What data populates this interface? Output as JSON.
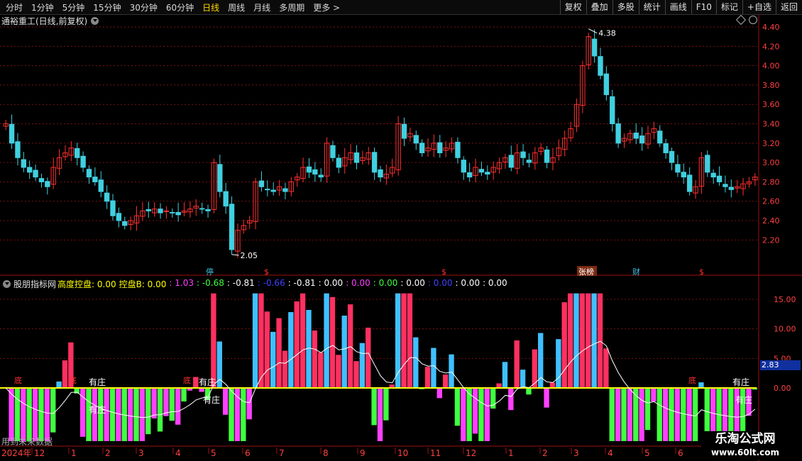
{
  "toolbar": {
    "periods": [
      "分时",
      "1分钟",
      "5分钟",
      "15分钟",
      "30分钟",
      "60分钟",
      "日线",
      "周线",
      "月线",
      "多周期",
      "更多 >"
    ],
    "active_period": "日线",
    "actions": [
      "复权",
      "叠加",
      "多股",
      "统计",
      "画线",
      "F10",
      "标记",
      "+自选",
      "返回"
    ]
  },
  "upper_chart": {
    "title": "通裕重工(日线,前复权)",
    "price_axis_labels": [
      "4.40",
      "4.20",
      "4.00",
      "3.80",
      "3.60",
      "3.40",
      "3.20",
      "3.00",
      "2.80",
      "2.60",
      "2.40",
      "2.20"
    ],
    "max_label": "4.38",
    "min_label": "2.05",
    "event_markers": [
      {
        "text": "停",
        "color": "#40c0e0"
      },
      {
        "text": "$",
        "color": "#ff3030"
      },
      {
        "text": "$",
        "color": "#ff3030"
      },
      {
        "text": "张榜",
        "color": "#ffffff"
      },
      {
        "text": "财",
        "color": "#40c0e0"
      },
      {
        "text": "$",
        "color": "#ff3030"
      }
    ]
  },
  "lower_chart": {
    "title": "股朋指标网",
    "readouts": [
      {
        "text": "高度控盘: 0.00",
        "color": "#ffff00"
      },
      {
        "text": "控盘B: 0.00",
        "color": "#ffff00"
      },
      {
        "text": ": 1.03",
        "color": "#ff40ff"
      },
      {
        "text": ": -0.68",
        "color": "#40ff40"
      },
      {
        "text": ": -0.81",
        "color": "#ffffff"
      },
      {
        "text": ": -0.66",
        "color": "#4040ff"
      },
      {
        "text": ": -0.81",
        "color": "#ffffff"
      },
      {
        "text": ": 0.00",
        "color": "#ffffff"
      },
      {
        "text": ": 0.00",
        "color": "#ff40ff"
      },
      {
        "text": ": 0.00",
        "color": "#40ff40"
      },
      {
        "text": ": 0.00",
        "color": "#ffffff"
      },
      {
        "text": ": 0.00",
        "color": "#4040ff"
      },
      {
        "text": ": 0.00",
        "color": "#ffffff"
      },
      {
        "text": ": 0.00",
        "color": "#ffffff"
      }
    ],
    "axis_labels": [
      "15.00",
      "10.00",
      "5.00",
      "0.00"
    ],
    "current_value": "2.83",
    "signal_labels": [
      "有庄",
      "有庄",
      "有庄",
      "有庄",
      "有庄",
      "有庄"
    ],
    "bottom_labels": [
      "底",
      "底",
      "底",
      "底"
    ],
    "future_note": "用到未来数据"
  },
  "time_axis": {
    "year_label": "2024年",
    "months": [
      "12",
      "1",
      "2",
      "3",
      "4",
      "5",
      "6",
      "7",
      "8",
      "9",
      "10",
      "11",
      "12",
      "1",
      "2",
      "3",
      "4",
      "5",
      "6"
    ]
  },
  "watermark": {
    "line1": "乐淘公式网",
    "line2": "www.60lt.com"
  },
  "colors": {
    "up": "#ff3030",
    "down": "#40d0e0",
    "axis_text": "#ff4040",
    "grid": "#7a1010",
    "yellow_line": "#ffff00"
  },
  "chart_data": {
    "type": "candlestick",
    "ylim": [
      2.05,
      4.4
    ],
    "close_series": [
      3.4,
      3.2,
      3.05,
      2.95,
      2.9,
      2.85,
      2.8,
      2.75,
      2.95,
      3.05,
      3.1,
      3.15,
      3.05,
      2.95,
      2.85,
      2.8,
      2.7,
      2.6,
      2.45,
      2.4,
      2.35,
      2.4,
      2.45,
      2.5,
      2.5,
      2.52,
      2.48,
      2.5,
      2.48,
      2.46,
      2.5,
      2.52,
      2.55,
      2.52,
      2.5,
      3.0,
      2.7,
      2.55,
      2.1,
      2.3,
      2.35,
      2.4,
      2.8,
      2.75,
      2.72,
      2.7,
      2.75,
      2.7,
      2.8,
      2.85,
      2.95,
      2.9,
      2.88,
      2.85,
      3.2,
      3.05,
      2.95,
      3.05,
      3.1,
      3.0,
      3.05,
      3.1,
      2.9,
      2.85,
      2.88,
      2.95,
      3.4,
      3.25,
      3.3,
      3.2,
      3.1,
      3.15,
      3.2,
      3.1,
      3.15,
      3.2,
      3.05,
      2.9,
      2.85,
      2.95,
      2.9,
      2.88,
      2.95,
      3.0,
      3.05,
      2.95,
      3.1,
      3.05,
      3.0,
      3.1,
      3.15,
      3.0,
      3.05,
      3.15,
      3.25,
      3.35,
      3.6,
      4.0,
      4.3,
      4.1,
      3.9,
      3.7,
      3.4,
      3.2,
      3.25,
      3.3,
      3.25,
      3.2,
      3.3,
      3.35,
      3.2,
      3.1,
      3.0,
      2.9,
      2.85,
      2.7,
      2.75,
      3.05,
      2.9,
      2.85,
      2.8,
      2.75,
      2.72,
      2.75,
      2.78,
      2.8,
      2.85
    ]
  }
}
